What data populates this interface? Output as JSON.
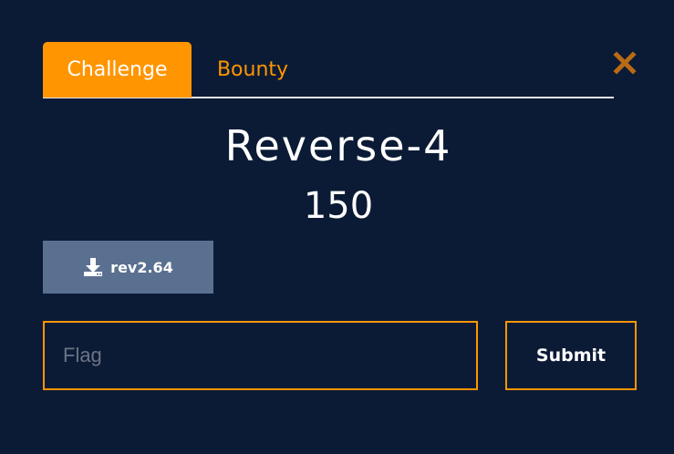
{
  "tabs": [
    {
      "label": "Challenge",
      "active": true
    },
    {
      "label": "Bounty",
      "active": false
    }
  ],
  "close_icon": "close-icon",
  "challenge": {
    "name": "Reverse-4",
    "points": "150"
  },
  "download": {
    "filename": "rev2.64",
    "icon": "download-icon"
  },
  "flag": {
    "value": "",
    "placeholder": "Flag"
  },
  "submit_label": "Submit",
  "colors": {
    "background": "#0b1b36",
    "accent": "#ff9500",
    "download_bg": "#5a7090",
    "close_icon": "#b86a14"
  }
}
